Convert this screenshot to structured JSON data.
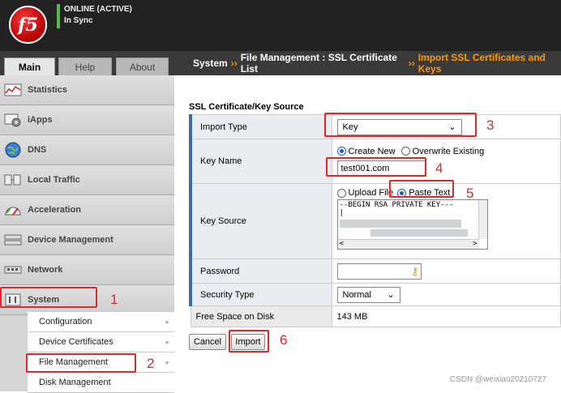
{
  "header": {
    "logo_text": "f5",
    "status_line1": "ONLINE (ACTIVE)",
    "status_line2": "In Sync"
  },
  "tabs": [
    {
      "label": "Main"
    },
    {
      "label": "Help"
    },
    {
      "label": "About"
    }
  ],
  "breadcrumb": {
    "part1": "System",
    "sep": "››",
    "part2": "File Management : SSL Certificate List",
    "current": "Import SSL Certificates and Keys"
  },
  "sidebar": {
    "items": [
      {
        "label": "Statistics",
        "icon": "statistics-icon"
      },
      {
        "label": "iApps",
        "icon": "iapps-icon"
      },
      {
        "label": "DNS",
        "icon": "dns-icon"
      },
      {
        "label": "Local Traffic",
        "icon": "local-traffic-icon"
      },
      {
        "label": "Acceleration",
        "icon": "acceleration-icon"
      },
      {
        "label": "Device Management",
        "icon": "device-management-icon"
      },
      {
        "label": "Network",
        "icon": "network-icon"
      },
      {
        "label": "System",
        "icon": "system-icon"
      }
    ],
    "subitems": [
      {
        "label": "Configuration"
      },
      {
        "label": "Device Certificates"
      },
      {
        "label": "File Management"
      },
      {
        "label": "Disk Management"
      }
    ]
  },
  "form": {
    "section_title": "SSL Certificate/Key Source",
    "import_type_label": "Import Type",
    "import_type_value": "Key",
    "key_name_label": "Key Name",
    "create_new_label": "Create New",
    "overwrite_label": "Overwrite Existing",
    "key_name_value": "test001.com",
    "key_source_label": "Key Source",
    "upload_file_label": "Upload File",
    "paste_text_label": "Paste Text",
    "key_text_line1": "--BEGIN RSA PRIVATE KEY---",
    "key_text_line2": "|",
    "password_label": "Password",
    "security_type_label": "Security Type",
    "security_type_value": "Normal",
    "free_space_label": "Free Space on Disk",
    "free_space_value": "143 MB"
  },
  "buttons": {
    "cancel": "Cancel",
    "import": "Import"
  },
  "annotations": [
    "1",
    "2",
    "3",
    "4",
    "5",
    "6"
  ],
  "watermark": "CSDN @weixiao20210727",
  "colors": {
    "annotation_red": "#e3262a",
    "breadcrumb_accent": "#ff9900",
    "status_green": "#54b948",
    "f5_red": "#c00000"
  }
}
